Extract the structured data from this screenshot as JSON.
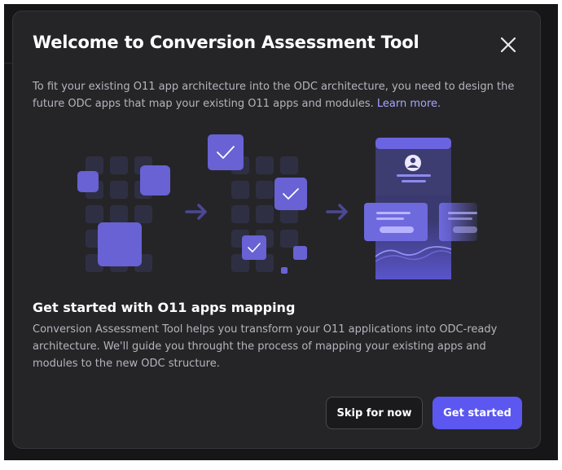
{
  "dialog": {
    "title": "Welcome to Conversion Assessment Tool",
    "close_icon": "close-icon",
    "intro_text": "To fit your existing O11 app architecture into the ODC architecture, you need to design the future ODC apps that map your existing O11 apps and modules. ",
    "learn_more_label": "Learn more.",
    "illustration_icons": [
      "module-grid-icon",
      "arrow-right-icon",
      "checked-grid-icon",
      "arrow-right-icon",
      "app-mockup-icon"
    ],
    "section_title": "Get started with O11 apps mapping",
    "section_body": "Conversion Assessment Tool helps you transform your O11 applications into ODC-ready architecture. We'll guide you throught the process of mapping your existing apps and modules to the new ODC structure.",
    "skip_label": "Skip for now",
    "start_label": "Get started"
  },
  "colors": {
    "backdrop": "#161618",
    "dialog_background": "#252528",
    "accent": "#5b57f0",
    "link": "#a7a4ff",
    "text_primary": "#ffffff",
    "text_secondary": "#b4b4bc"
  }
}
